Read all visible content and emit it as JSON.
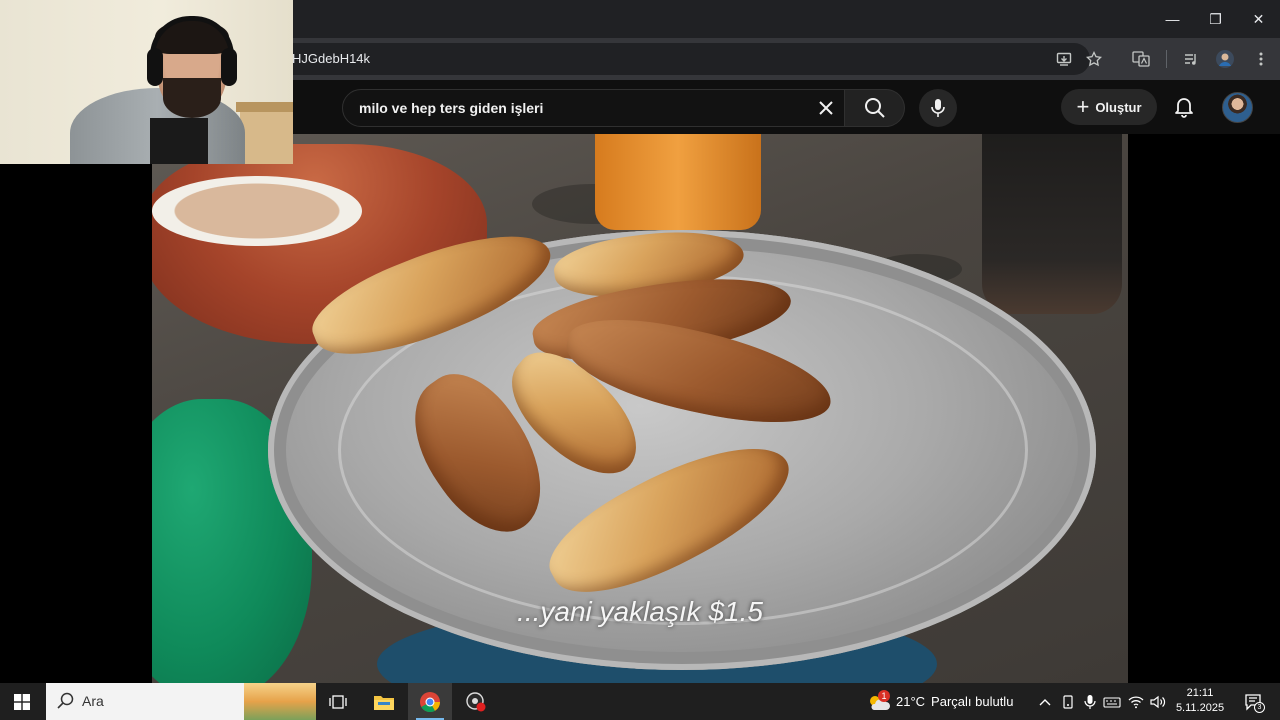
{
  "browser": {
    "url_fragment": "HJGdebH14k",
    "window_controls": {
      "minimize": "—",
      "restore": "❐",
      "close": "✕"
    }
  },
  "youtube": {
    "search_query": "milo ve hep ters giden işleri",
    "create_label": "Oluştur"
  },
  "video": {
    "subtitle": "...yani yaklaşık $1.5"
  },
  "taskbar": {
    "search_placeholder": "Ara",
    "weather_temp": "21°C",
    "weather_desc": "Parçalı bulutlu",
    "weather_badge": "1",
    "time": "21:11",
    "date": "5.11.2025",
    "notification_count": "3"
  },
  "colors": {
    "chrome_titlebar": "#202124",
    "chrome_toolbar": "#35363a",
    "yt_header": "#0f0f0f",
    "taskbar": "#1f1f1f"
  }
}
